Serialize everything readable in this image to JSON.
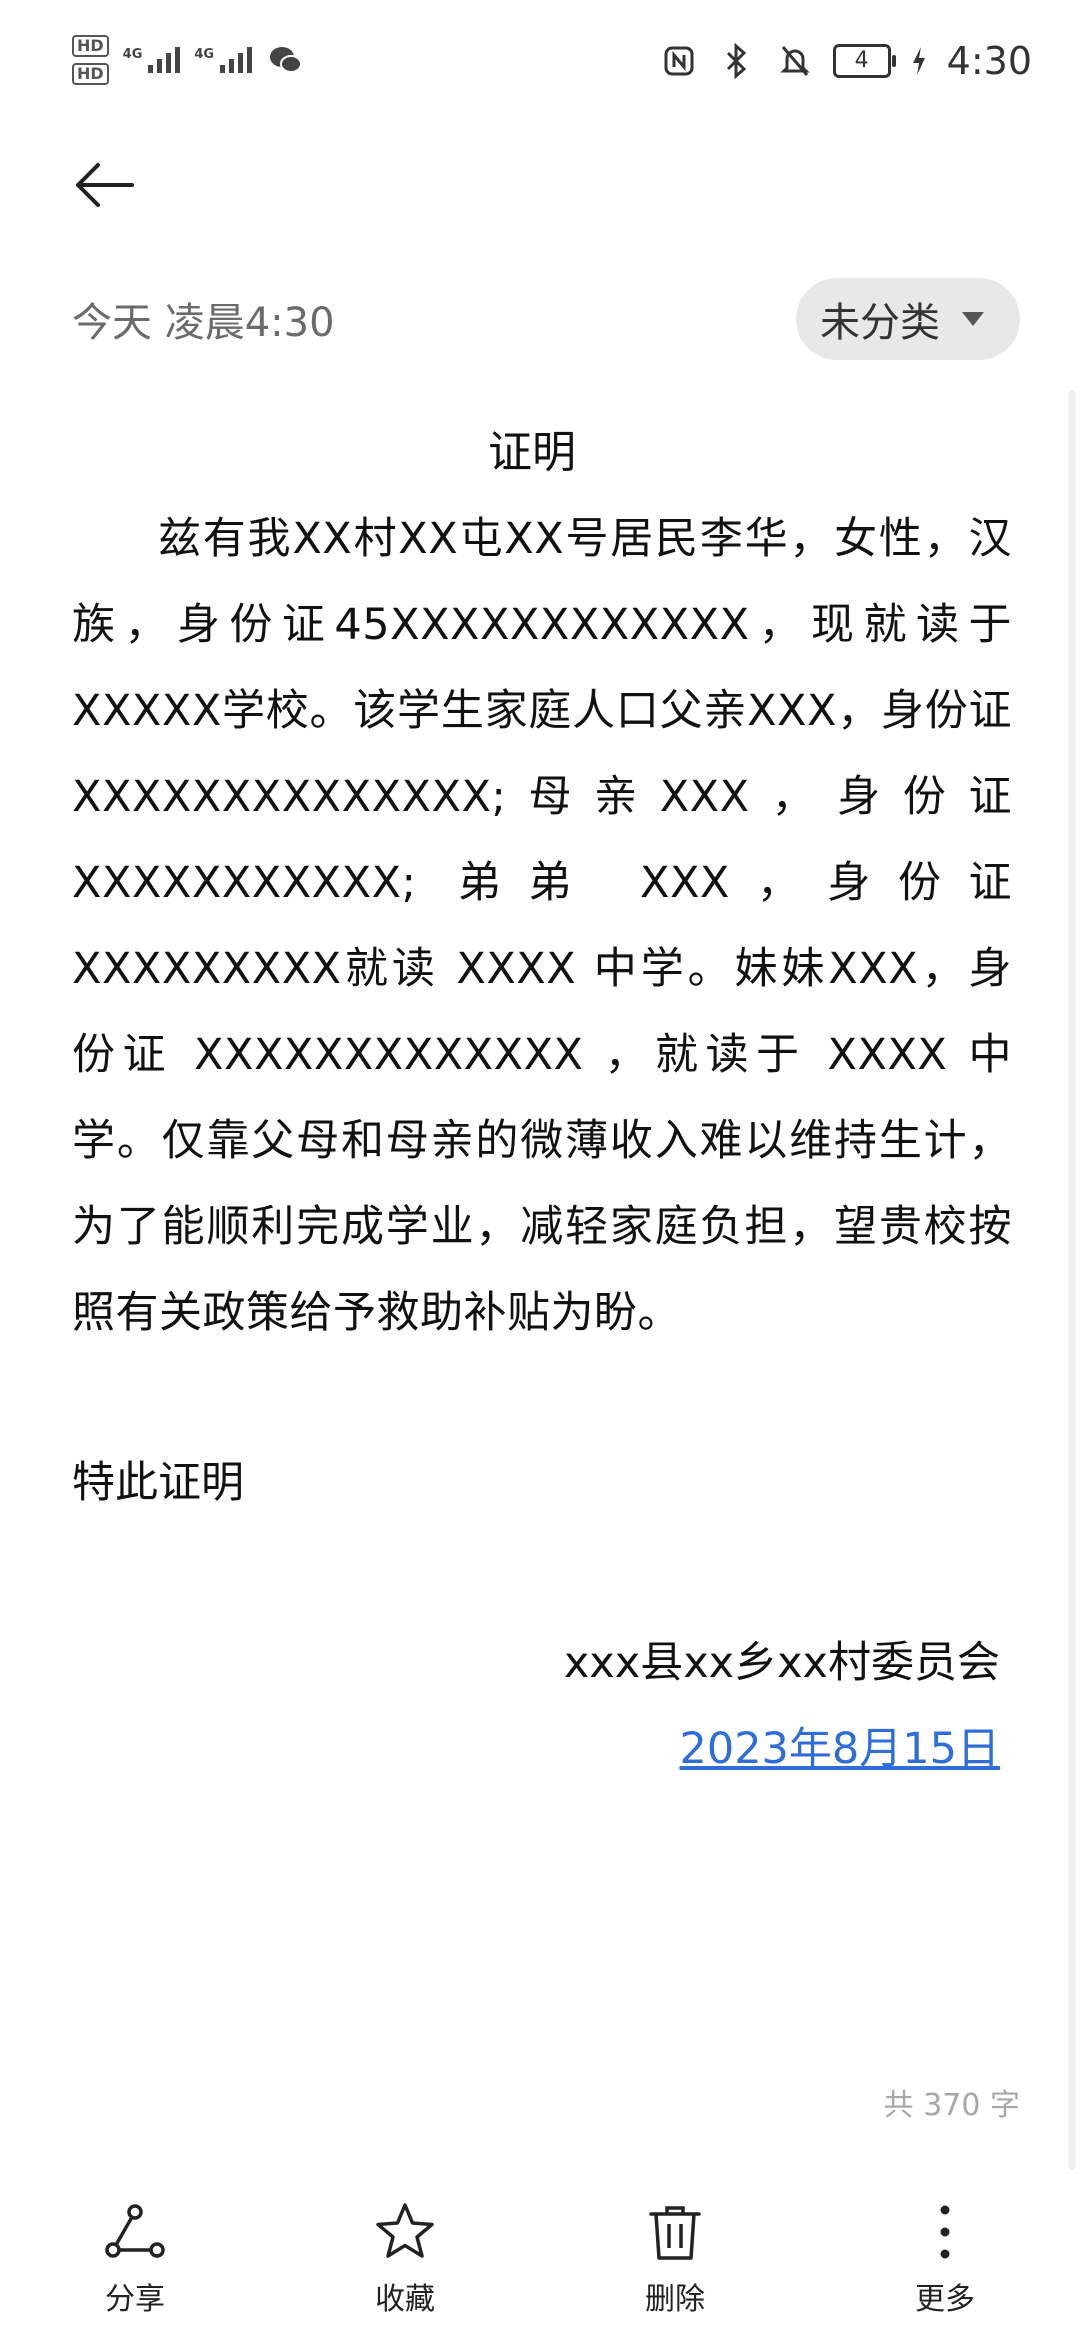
{
  "status_bar": {
    "sim1_label": "HD",
    "sim2_label": "HD",
    "network1": "4G",
    "network2": "4G",
    "battery": "4",
    "time": "4:30",
    "icons": [
      "nfc-icon",
      "bluetooth-icon",
      "mute-bell-icon",
      "battery-icon",
      "charging-icon",
      "wechat-icon"
    ]
  },
  "header": {
    "back_icon": "back-arrow-icon",
    "timestamp": "今天 凌晨4:30",
    "category_label": "未分类"
  },
  "document": {
    "title": "证明",
    "body": "兹有我XX村XX屯XX号居民李华，女性，汉族，身份证45XXXXXXXXXXXX，现就读于XXXXX学校。该学生家庭人口父亲XXX，身份证XXXXXXXXXXXXXX;母亲XXX，身份证XXXXXXXXXXX; 弟弟 XXX，身份证XXXXXXXXX就读 XXXX 中学。妹妹XXX，身份证 XXXXXXXXXXXXX ，就读于 XXXX 中学。仅靠父母和母亲的微薄收入难以维持生计，为了能顺利完成学业，减轻家庭负担，望贵校按照有关政策给予救助补贴为盼。",
    "closing": "特此证明",
    "organization": "xxx县xx乡xx村委员会",
    "date": "2023年8月15日"
  },
  "word_count": "共 370 字",
  "toolbar": {
    "share": "分享",
    "favorite": "收藏",
    "delete": "删除",
    "more": "更多"
  },
  "colors": {
    "link": "#2f6ed8",
    "meta_text": "#6b6b6b",
    "chip_bg": "#e8e8e8"
  }
}
